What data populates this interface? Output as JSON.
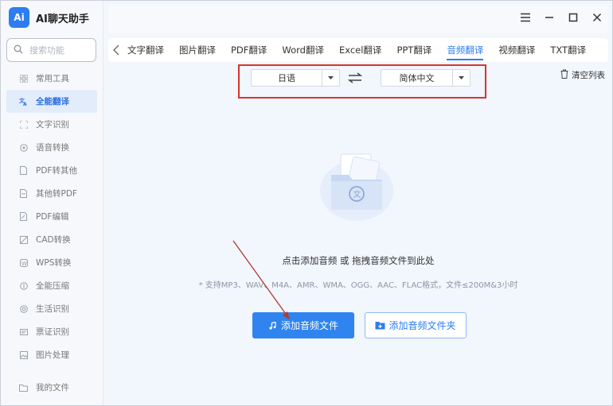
{
  "app": {
    "logo_text": "Ai",
    "title": "AI聊天助手"
  },
  "search": {
    "placeholder": "搜索功能"
  },
  "sidebar": {
    "items": [
      {
        "label": "常用工具",
        "icon": "grid-icon"
      },
      {
        "label": "全能翻译",
        "icon": "translate-icon",
        "active": true
      },
      {
        "label": "文字识别",
        "icon": "scan-text-icon"
      },
      {
        "label": "语音转换",
        "icon": "voice-icon"
      },
      {
        "label": "PDF转其他",
        "icon": "pdf-convert-icon"
      },
      {
        "label": "其他转PDF",
        "icon": "to-pdf-icon"
      },
      {
        "label": "PDF编辑",
        "icon": "pdf-edit-icon"
      },
      {
        "label": "CAD转换",
        "icon": "cad-icon"
      },
      {
        "label": "WPS转换",
        "icon": "wps-icon"
      },
      {
        "label": "全能压缩",
        "icon": "compress-icon"
      },
      {
        "label": "生活识别",
        "icon": "life-scan-icon"
      },
      {
        "label": "票证识别",
        "icon": "ticket-icon"
      },
      {
        "label": "图片处理",
        "icon": "image-icon"
      }
    ],
    "bottom": {
      "label": "我的文件",
      "icon": "folder-icon"
    }
  },
  "tabs": [
    {
      "label": "文字翻译"
    },
    {
      "label": "图片翻译"
    },
    {
      "label": "PDF翻译"
    },
    {
      "label": "Word翻译"
    },
    {
      "label": "Excel翻译"
    },
    {
      "label": "PPT翻译"
    },
    {
      "label": "音频翻译",
      "active": true
    },
    {
      "label": "视频翻译"
    },
    {
      "label": "TXT翻译"
    }
  ],
  "language": {
    "source": "日语",
    "target": "简体中文"
  },
  "toolbar": {
    "clear_label": "清空列表"
  },
  "upload": {
    "hint": "点击添加音频 或 拖拽音频文件到此处",
    "formats": "* 支持MP3、WAV、M4A、AMR、WMA、OGG、AAC、FLAC格式，文件≤200M&3小时",
    "add_file_label": "添加音频文件",
    "add_folder_label": "添加音频文件夹"
  },
  "colors": {
    "accent": "#2c7df2",
    "highlight_box": "#d7342b",
    "arrow": "#b23a2e"
  }
}
